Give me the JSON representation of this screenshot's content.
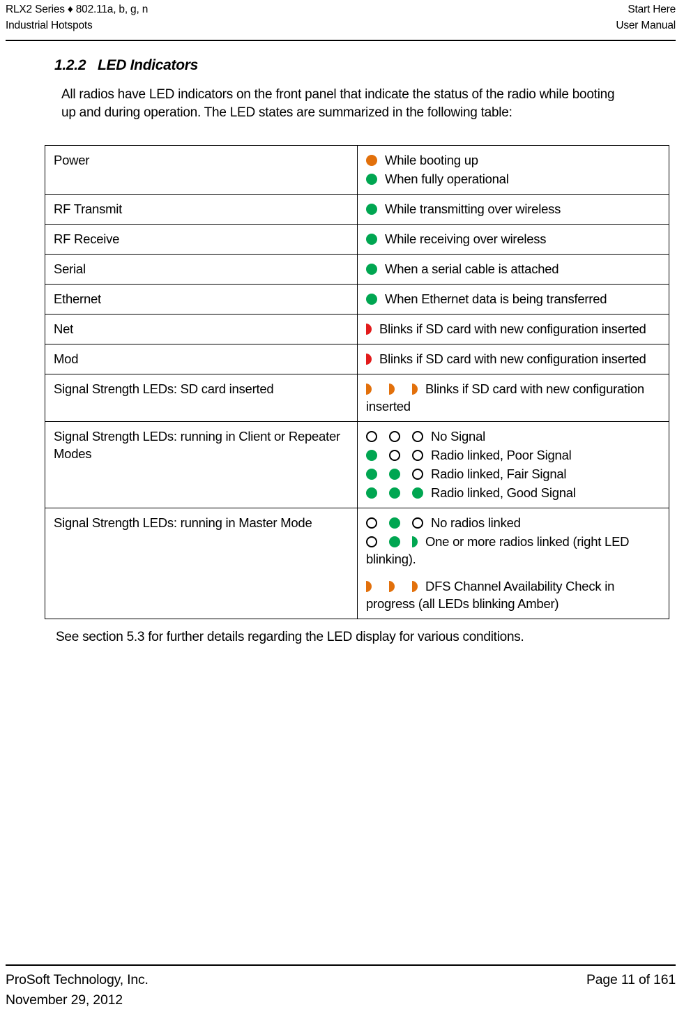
{
  "header": {
    "left_line1": "RLX2 Series ♦ 802.11a, b, g, n",
    "left_line2": "Industrial Hotspots",
    "right_line1": "Start Here",
    "right_line2": "User Manual"
  },
  "section": {
    "number": "1.2.2",
    "title": "LED Indicators",
    "intro": "All radios have LED indicators on the front panel that indicate the status of the radio while booting up and during operation. The LED states are summarized in the following table:",
    "after_table": "See section 5.3 for further details regarding the LED display for various conditions."
  },
  "colors": {
    "green": "#00A651",
    "orange": "#E2700B",
    "red": "#E21B1B",
    "off_outline": "#000000"
  },
  "table": {
    "rows": [
      {
        "name": "Power",
        "lines": [
          {
            "leds": [
              "orange"
            ],
            "text": "While booting up"
          },
          {
            "leds": [
              "green"
            ],
            "text": "When fully operational"
          }
        ]
      },
      {
        "name": "RF Transmit",
        "lines": [
          {
            "leds": [
              "green"
            ],
            "text": "While transmitting over wireless"
          }
        ]
      },
      {
        "name": "RF Receive",
        "lines": [
          {
            "leds": [
              "green"
            ],
            "text": "While receiving over wireless"
          }
        ]
      },
      {
        "name": "Serial",
        "lines": [
          {
            "leds": [
              "green"
            ],
            "text": "When a serial cable is attached"
          }
        ]
      },
      {
        "name": "Ethernet",
        "lines": [
          {
            "leds": [
              "green"
            ],
            "text": "When Ethernet data is being transferred"
          }
        ]
      },
      {
        "name": "Net",
        "lines": [
          {
            "leds": [
              "blink-red"
            ],
            "text": "Blinks if SD card with new configuration inserted"
          }
        ]
      },
      {
        "name": "Mod",
        "lines": [
          {
            "leds": [
              "blink-red"
            ],
            "text": "Blinks if SD card with new configuration inserted"
          }
        ]
      },
      {
        "name": "Signal Strength LEDs: SD card inserted",
        "lines": [
          {
            "leds": [
              "blink-orange",
              "blink-orange",
              "blink-orange"
            ],
            "text": "Blinks if SD card with new configuration inserted"
          }
        ]
      },
      {
        "name": "Signal Strength LEDs: running in Client or Repeater Modes",
        "lines": [
          {
            "leds": [
              "off",
              "off",
              "off"
            ],
            "text": "No Signal"
          },
          {
            "leds": [
              "green",
              "off",
              "off"
            ],
            "text": "Radio linked, Poor Signal"
          },
          {
            "leds": [
              "green",
              "green",
              "off"
            ],
            "text": "Radio linked, Fair Signal"
          },
          {
            "leds": [
              "green",
              "green",
              "green"
            ],
            "text": "Radio linked, Good Signal"
          }
        ]
      },
      {
        "name": "Signal Strength LEDs: running in Master Mode",
        "lines": [
          {
            "leds": [
              "off",
              "green",
              "off"
            ],
            "text": "No radios linked"
          },
          {
            "leds": [
              "off",
              "green",
              "blink-green"
            ],
            "text": "One or more radios linked (right LED blinking)."
          },
          {
            "leds": [
              "blink-orange",
              "blink-orange",
              "blink-orange"
            ],
            "text": "DFS Channel Availability Check in progress (all LEDs blinking Amber)",
            "gap": true
          }
        ]
      }
    ]
  },
  "footer": {
    "left_line1": "ProSoft Technology, Inc.",
    "left_line2": "November 29, 2012",
    "right_line1": "Page 11 of 161"
  }
}
